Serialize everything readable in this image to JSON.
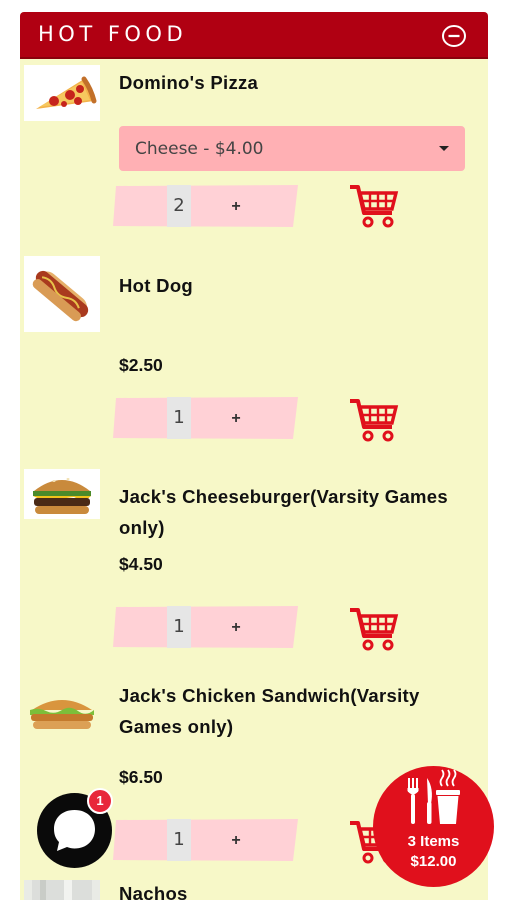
{
  "header": {
    "title": "HOT FOOD",
    "collapse_icon": "minus-circle-icon"
  },
  "items": [
    {
      "name": "Domino's Pizza",
      "image_icon": "pizza-slice-image",
      "option": {
        "selected": "Cheese - $4.00"
      },
      "quantity": "2",
      "plus": "+",
      "cart_icon": "shopping-cart-icon"
    },
    {
      "name": "Hot Dog",
      "image_icon": "hot-dog-image",
      "price": "$2.50",
      "quantity": "1",
      "plus": "+",
      "cart_icon": "shopping-cart-icon"
    },
    {
      "name": "Jack's Cheeseburger(Varsity Games only)",
      "image_icon": "cheeseburger-image",
      "price": "$4.50",
      "quantity": "1",
      "plus": "+",
      "cart_icon": "shopping-cart-icon"
    },
    {
      "name": "Jack's Chicken Sandwich(Varsity Games only)",
      "image_icon": "chicken-sandwich-image",
      "price": "$6.50",
      "quantity": "1",
      "plus": "+",
      "cart_icon": "shopping-cart-icon"
    },
    {
      "name": "Nachos",
      "image_icon": "nachos-image"
    }
  ],
  "chat": {
    "badge": "1",
    "icon": "chat-bubble-icon"
  },
  "order": {
    "count_label": "3 Items",
    "total": "$12.00",
    "icon": "utensils-cup-icon"
  },
  "colors": {
    "header": "#b00012",
    "panel": "#f7f8c8",
    "select": "#ffb0b4",
    "qty": "#ffd1d6",
    "cart": "#e0101c",
    "fab": "#e0101c",
    "badge": "#e8273a"
  }
}
